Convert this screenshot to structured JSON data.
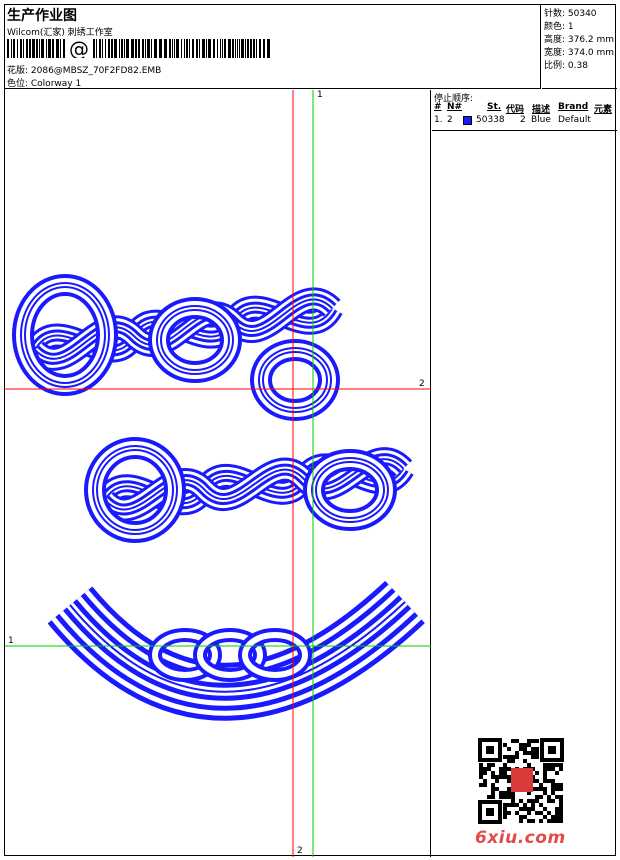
{
  "header": {
    "title": "生产作业图",
    "company": "Wilcom(汇家) 刺绣工作室",
    "design_file": "花版: 2086@MBSZ_70F2FD82.EMB",
    "colorway": "色位: Colorway 1",
    "barcode_glyph": "@"
  },
  "stats": {
    "stitches": "针数: 50340",
    "colors": "颜色: 1",
    "height": "高度: 376.2 mm",
    "width": "宽度: 374.0 mm",
    "scale": "比例: 0.38"
  },
  "stop_sequence": {
    "heading": "停止顺序:",
    "columns": [
      "#",
      "N#",
      "St.",
      "代码",
      "描述",
      "Brand",
      "元素"
    ],
    "rows": [
      {
        "index": "1.",
        "needle": "2",
        "stitches": "50338",
        "code": "2",
        "description": "Blue",
        "brand": "Default",
        "swatch_color": "#1a1aff"
      }
    ]
  },
  "design_area": {
    "stitch_color": "#1a1aff",
    "axis_labels": {
      "red_vertical": "2",
      "red_horizontal": "2",
      "green_vertical": "1",
      "green_horizontal": "1"
    }
  },
  "watermark": {
    "site": "6xiu.com"
  }
}
